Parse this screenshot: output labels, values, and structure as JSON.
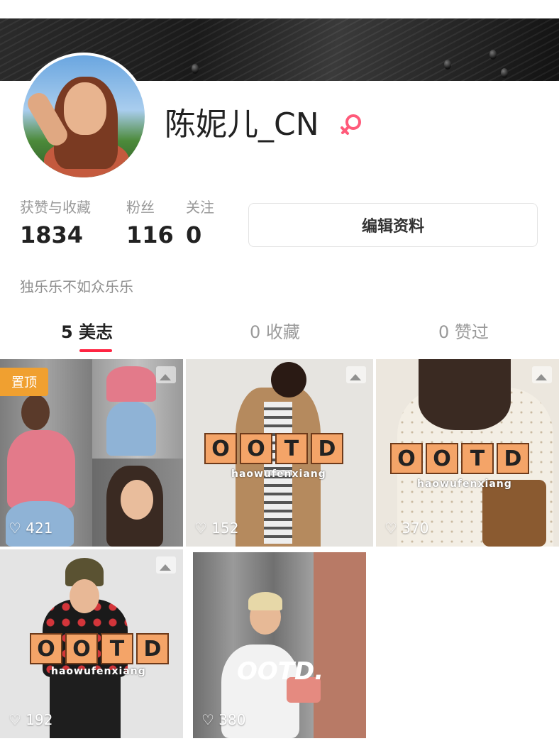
{
  "profile": {
    "username": "陈妮儿_CN",
    "gender_icon": "female-icon",
    "bio": "独乐乐不如众乐乐"
  },
  "stats": [
    {
      "label": "获赞与收藏",
      "value": "1834"
    },
    {
      "label": "粉丝",
      "value": "116"
    },
    {
      "label": "关注",
      "value": "0"
    }
  ],
  "edit_profile_label": "编辑资料",
  "tabs": [
    {
      "label": "5 美志",
      "active": true
    },
    {
      "label": "0 收藏",
      "active": false
    },
    {
      "label": "0 赞过",
      "active": false
    }
  ],
  "posts": [
    {
      "likes": "421",
      "badge": "置顶"
    },
    {
      "likes": "152",
      "ootd": "OOTD",
      "ootd_sub": "haowufenxiang"
    },
    {
      "likes": "370",
      "ootd": "OOTD",
      "ootd_sub": "haowufenxiang"
    },
    {
      "likes": "192",
      "ootd": "OOTD",
      "ootd_sub": "haowufenxiang"
    },
    {
      "likes": "380",
      "ootd": "OOTD."
    }
  ],
  "colors": {
    "accent": "#ff2442",
    "badge": "#f0a030"
  }
}
